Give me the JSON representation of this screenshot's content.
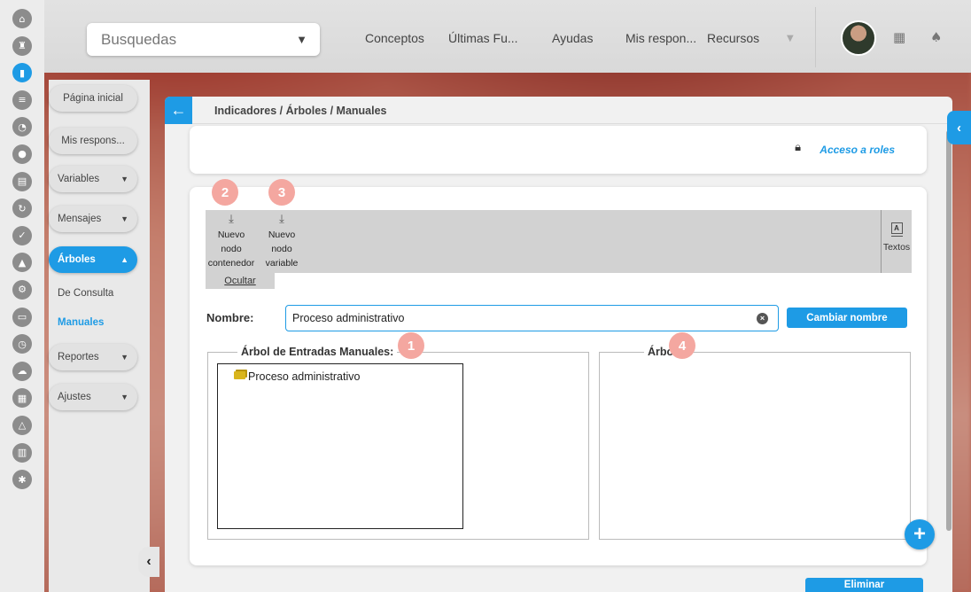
{
  "colors": {
    "accent": "#1e9be5",
    "marker": "#f4a7a0"
  },
  "rail_icons": [
    "home-icon",
    "chess-icon",
    "chart-icon",
    "list-icon",
    "pie-icon",
    "globe-icon",
    "document-icon",
    "cycle-icon",
    "check-icon",
    "warning-icon",
    "gears-icon",
    "monitor-icon",
    "clock-icon",
    "cloud-icon",
    "calendar-icon",
    "network-icon",
    "notes-icon",
    "settings-icon"
  ],
  "topbar": {
    "search_select": "Busquedas",
    "nav": [
      "Conceptos",
      "Últimas Fu...",
      "Ayudas",
      "Mis respon...",
      "Recursos"
    ]
  },
  "sidemenu": {
    "home": "Página inicial",
    "my_resp": "Mis respons...",
    "variables": "Variables",
    "mensajes": "Mensajes",
    "arboles": "Árboles",
    "sub_consulta": "De Consulta",
    "sub_manuales": "Manuales",
    "reportes": "Reportes",
    "ajustes": "Ajustes"
  },
  "main": {
    "breadcrumb": "Indicadores / Árboles / Manuales",
    "access_roles": "Acceso a roles",
    "toolbar": {
      "new_container": [
        "Nuevo",
        "nodo",
        "contenedor"
      ],
      "new_variable": [
        "Nuevo",
        "nodo",
        "variable"
      ],
      "texts": "Textos",
      "hide": "Ocultar"
    },
    "name_label": "Nombre:",
    "name_value": "Proceso administrativo",
    "rename_button": "Cambiar nombre",
    "manual_tree_title": "Árbol de Entradas Manuales:",
    "manual_tree_root": "Proceso administrativo",
    "tree_title": "Árbol:",
    "delete_button": "Eliminar"
  },
  "markers": [
    "1",
    "2",
    "3",
    "4"
  ]
}
